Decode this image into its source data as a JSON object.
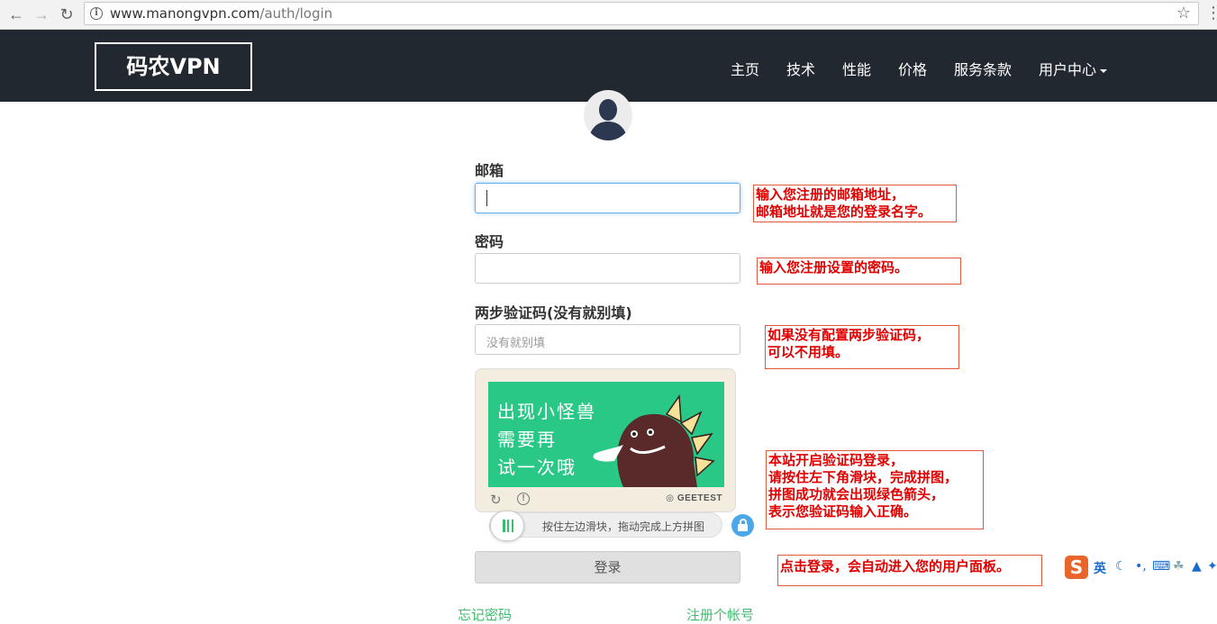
{
  "browser": {
    "url_host": "www.manongvpn.com",
    "url_path": "/auth/login"
  },
  "navbar": {
    "brand": "码农VPN",
    "items": [
      {
        "label": "主页"
      },
      {
        "label": "技术"
      },
      {
        "label": "性能"
      },
      {
        "label": "价格"
      },
      {
        "label": "服务条款"
      },
      {
        "label": "用户中心"
      }
    ]
  },
  "form": {
    "email_label": "邮箱",
    "email_value": "",
    "password_label": "密码",
    "password_value": "",
    "twofa_label": "两步验证码(没有就别填)",
    "twofa_placeholder": "没有就别填",
    "captcha": {
      "image_text_line1": "出现小怪兽",
      "image_text_line2": "需要再",
      "image_text_line3": "试一次哦",
      "brand": "GEETEST",
      "slider_hint": "按住左边滑块，拖动完成上方拼图"
    },
    "login_button": "登录",
    "forgot_password": "忘记密码",
    "register": "注册个帐号"
  },
  "annotations": {
    "email_line1": "输入您注册的邮箱地址，",
    "email_line2": "邮箱地址就是您的登录名字。",
    "password": "输入您注册设置的密码。",
    "twofa_line1": "如果没有配置两步验证码，",
    "twofa_line2": "可以不用填。",
    "captcha_line1": "本站开启验证码登录，",
    "captcha_line2": "请按住左下角滑块，完成拼图，",
    "captcha_line3": "拼图成功就会出现绿色箭头，",
    "captcha_line4": "表示您验证码输入正确。",
    "login": "点击登录，会自动进入您的用户面板。"
  },
  "ime": {
    "logo": "S",
    "mode": "英"
  },
  "colors": {
    "navbar_bg": "#222830",
    "accent_green": "#3cbd6d",
    "annotation_red": "#e00000",
    "captcha_green": "#29c887",
    "lock_blue": "#4ba7e8"
  }
}
